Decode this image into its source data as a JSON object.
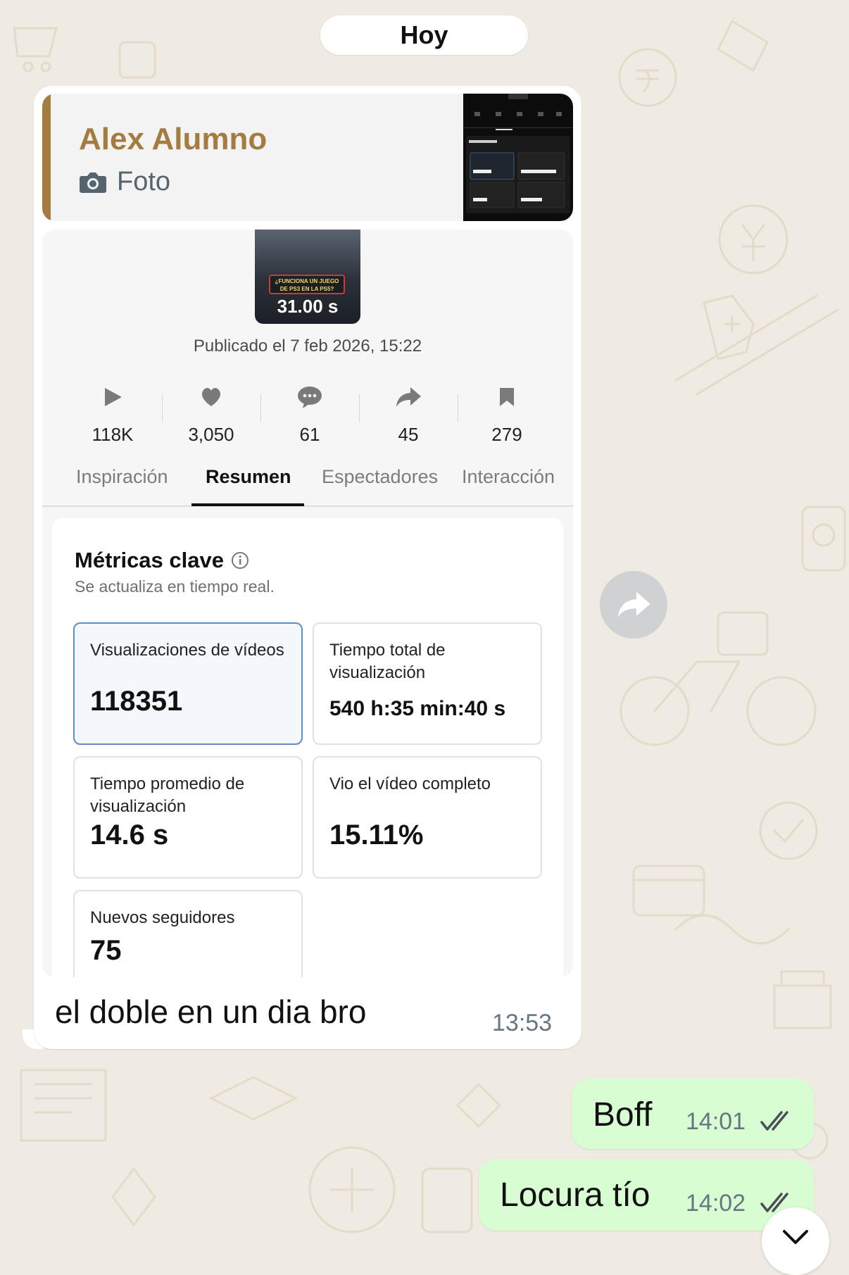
{
  "chat": {
    "date_separator": "Hoy"
  },
  "incoming": {
    "quote": {
      "author": "Alex Alumno",
      "type_label": "Foto"
    },
    "screenshot": {
      "video_caption": "¿FUNCIONA UN JUEGO DE PS3 EN LA PS5?",
      "duration": "31.00 s",
      "published": "Publicado el 7 feb 2026, 15:22",
      "stats": [
        {
          "icon": "play-icon",
          "value": "118K"
        },
        {
          "icon": "heart-icon",
          "value": "3,050"
        },
        {
          "icon": "comment-icon",
          "value": "61"
        },
        {
          "icon": "share-icon",
          "value": "45"
        },
        {
          "icon": "bookmark-icon",
          "value": "279"
        }
      ],
      "tabs": [
        "Inspiración",
        "Resumen",
        "Espectadores",
        "Interacción"
      ],
      "active_tab": "Resumen",
      "metrics_title": "Métricas clave",
      "metrics_subtitle": "Se actualiza en tiempo real.",
      "metrics": [
        {
          "label": "Visualizaciones de vídeos",
          "value": "118351"
        },
        {
          "label": "Tiempo total de visualización",
          "value": "540 h:35 min:40 s"
        },
        {
          "label": "Tiempo promedio de visualización",
          "value": "14.6 s"
        },
        {
          "label": "Vio el vídeo completo",
          "value": "15.11%"
        },
        {
          "label": "Nuevos seguidores",
          "value": "75"
        }
      ]
    },
    "text": "el doble en un dia bro",
    "time": "13:53"
  },
  "outgoing": [
    {
      "text": "Boff",
      "time": "14:01",
      "status": "read"
    },
    {
      "text": "Locura tío",
      "time": "14:02",
      "status": "read"
    }
  ],
  "colors": {
    "background": "#efeae2",
    "incoming_bubble": "#ffffff",
    "outgoing_bubble": "#d9fdd3",
    "quote_accent": "#a57c3f",
    "timestamp": "#667781"
  }
}
